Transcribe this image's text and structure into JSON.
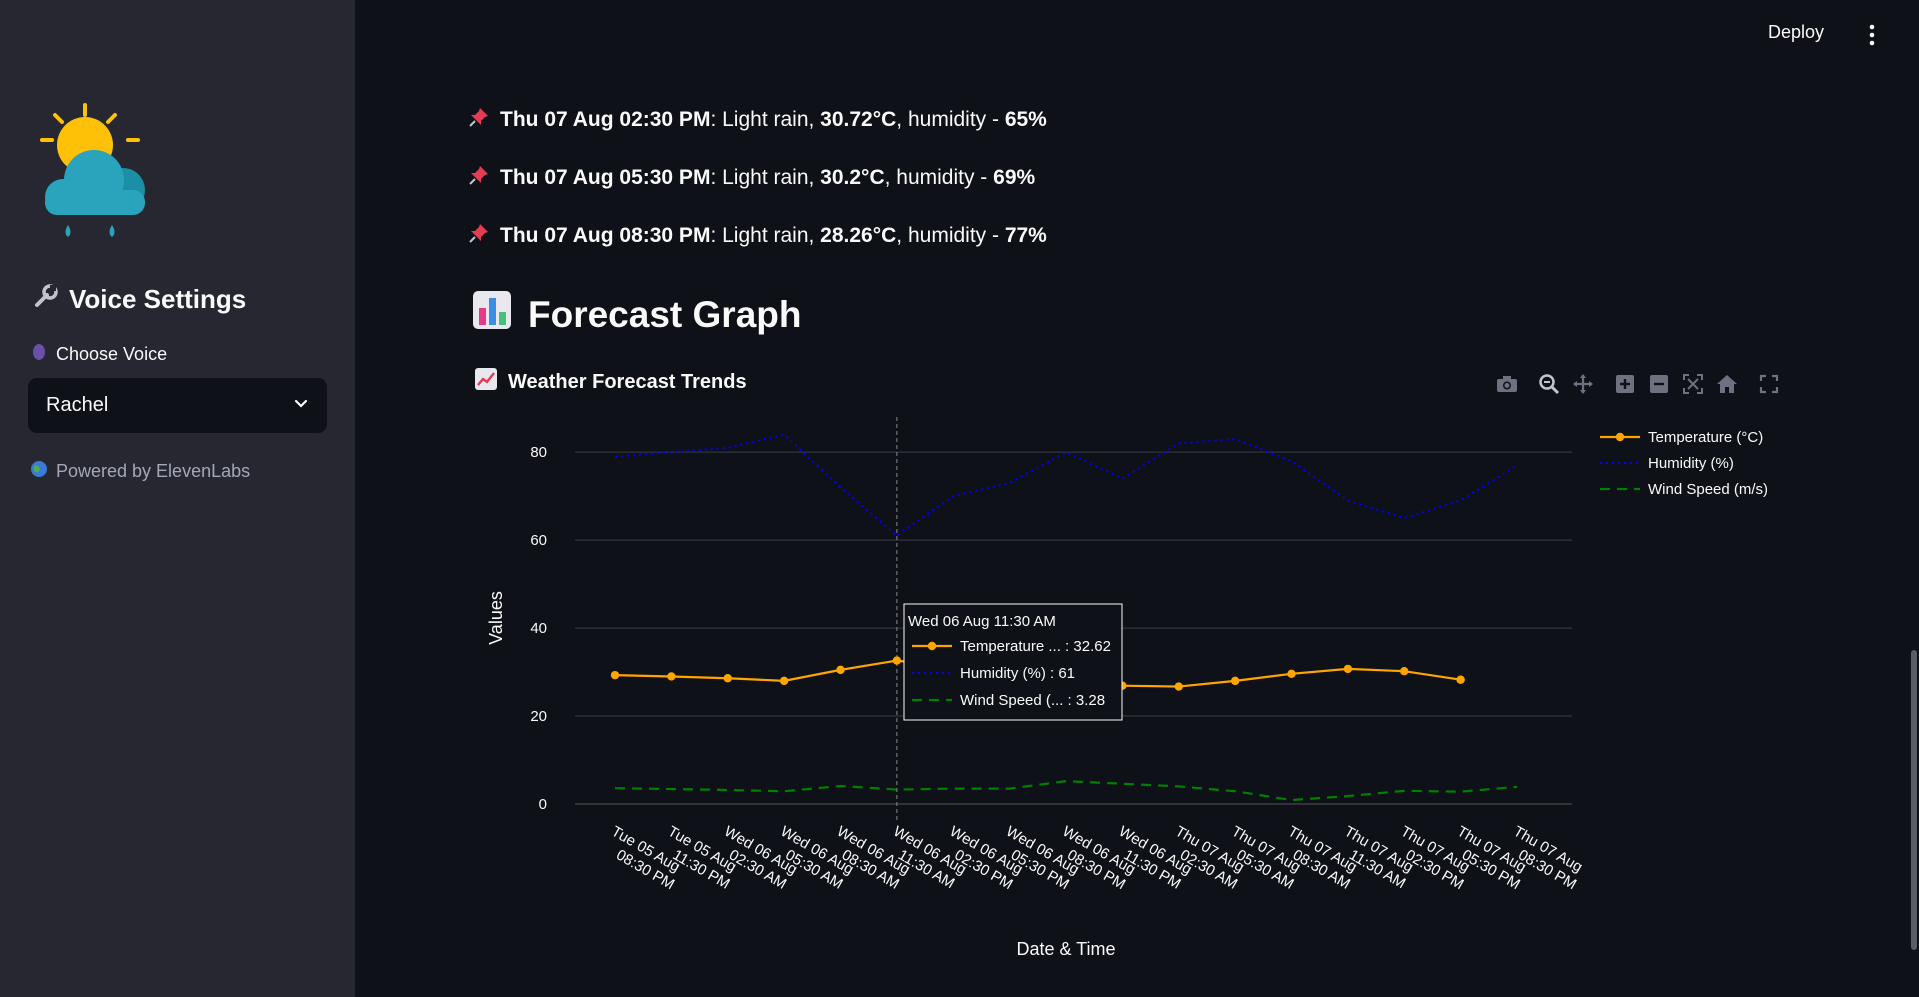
{
  "header": {
    "deploy_label": "Deploy"
  },
  "sidebar": {
    "heading": "Voice Settings",
    "voice_label": "Choose Voice",
    "voice_selected": "Rachel",
    "powered_by": "Powered by ElevenLabs"
  },
  "forecast_list": [
    {
      "time": "Thu 07 Aug 02:30 PM",
      "desc": "Light rain",
      "temp": "30.72°C",
      "humidity": "65%"
    },
    {
      "time": "Thu 07 Aug 05:30 PM",
      "desc": "Light rain",
      "temp": "30.2°C",
      "humidity": "69%"
    },
    {
      "time": "Thu 07 Aug 08:30 PM",
      "desc": "Light rain",
      "temp": "28.26°C",
      "humidity": "77%"
    }
  ],
  "forecast_text": {
    "sep": ": ",
    "comma": ", ",
    "humidity_prefix": ", humidity - "
  },
  "section_heading": "Forecast Graph",
  "chart_data": {
    "type": "line",
    "title": "Weather Forecast Trends",
    "xlabel": "Date & Time",
    "ylabel": "Values",
    "ylim": [
      0,
      88
    ],
    "yticks": [
      0,
      20,
      40,
      60,
      80
    ],
    "grid": true,
    "legend": "top-right",
    "categories": [
      "Tue 05 Aug 08:30 PM",
      "Tue 05 Aug 11:30 PM",
      "Wed 06 Aug 02:30 AM",
      "Wed 06 Aug 05:30 AM",
      "Wed 06 Aug 08:30 AM",
      "Wed 06 Aug 11:30 AM",
      "Wed 06 Aug 02:30 PM",
      "Wed 06 Aug 05:30 PM",
      "Wed 06 Aug 08:30 PM",
      "Wed 06 Aug 11:30 PM",
      "Thu 07 Aug 02:30 AM",
      "Thu 07 Aug 05:30 AM",
      "Thu 07 Aug 08:30 AM",
      "Thu 07 Aug 11:30 AM",
      "Thu 07 Aug 02:30 PM",
      "Thu 07 Aug 05:30 PM",
      "Thu 07 Aug 08:30 PM"
    ],
    "series": [
      {
        "name": "Temperature (°C)",
        "color": "#ffa500",
        "dash": "solid",
        "markers": true,
        "values": [
          29.3,
          29.0,
          28.6,
          28.0,
          30.5,
          32.62,
          30.8,
          29.0,
          27.8,
          26.9,
          26.7,
          28.0,
          29.6,
          30.72,
          30.2,
          28.26,
          null
        ]
      },
      {
        "name": "Humidity (%)",
        "color": "#0000ff",
        "dash": "dot",
        "markers": false,
        "values": [
          79,
          80,
          81,
          84,
          72,
          61,
          70,
          73,
          80,
          74,
          82,
          83,
          78,
          69,
          65,
          69,
          77
        ]
      },
      {
        "name": "Wind Speed (m/s)",
        "color": "#008000",
        "dash": "dash",
        "markers": false,
        "values": [
          3.6,
          3.4,
          3.2,
          2.9,
          4.1,
          3.28,
          3.5,
          3.5,
          5.2,
          4.6,
          4.0,
          2.9,
          0.9,
          1.8,
          3.0,
          2.8,
          3.9
        ]
      }
    ],
    "hover": {
      "title": "Wed 06 Aug 11:30 AM",
      "index": 5,
      "rows": [
        {
          "label": "Temperature ... : 32.62"
        },
        {
          "label": "Humidity (%) : 61"
        },
        {
          "label": "Wind Speed (... : 3.28"
        }
      ]
    }
  }
}
